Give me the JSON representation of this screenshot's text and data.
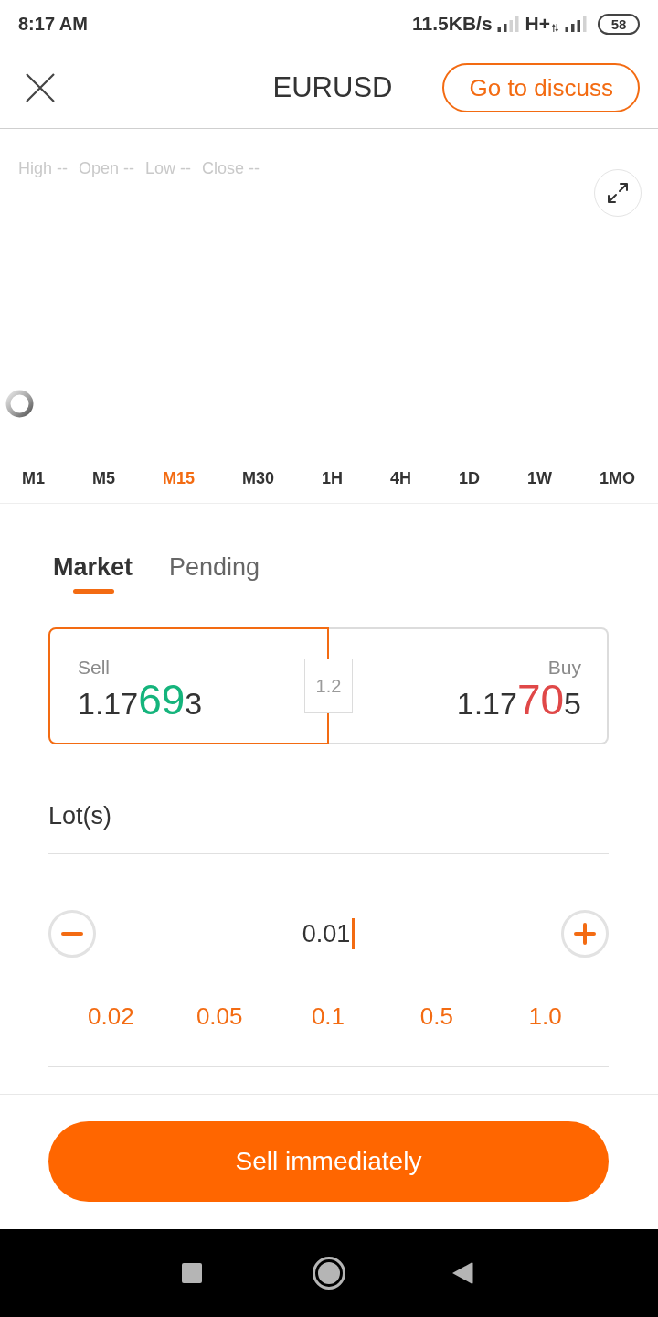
{
  "status_bar": {
    "time": "8:17 AM",
    "data_speed": "11.5KB/s",
    "network_type": "H+",
    "battery": "58"
  },
  "header": {
    "title": "EURUSD",
    "discuss_button": "Go to discuss"
  },
  "chart": {
    "readings": [
      "High --",
      "Open --",
      "Low --",
      "Close --"
    ],
    "loading": true
  },
  "timeframes": [
    {
      "label": "M1",
      "selected": false
    },
    {
      "label": "M5",
      "selected": false
    },
    {
      "label": "M15",
      "selected": true
    },
    {
      "label": "M30",
      "selected": false
    },
    {
      "label": "1H",
      "selected": false
    },
    {
      "label": "4H",
      "selected": false
    },
    {
      "label": "1D",
      "selected": false
    },
    {
      "label": "1W",
      "selected": false
    },
    {
      "label": "1MO",
      "selected": false
    }
  ],
  "order_tabs": [
    {
      "label": "Market",
      "selected": true
    },
    {
      "label": "Pending",
      "selected": false
    }
  ],
  "quote": {
    "sell": {
      "label": "Sell",
      "price": {
        "lead": "1.17",
        "pips": "69",
        "tail": "3"
      },
      "selected": true
    },
    "spread": "1.2",
    "buy": {
      "label": "Buy",
      "price": {
        "lead": "1.17",
        "pips": "70",
        "tail": "5"
      },
      "selected": false
    }
  },
  "lots": {
    "label": "Lot(s)",
    "value": "0.01",
    "focused": true,
    "presets": [
      "0.02",
      "0.05",
      "0.1",
      "0.5",
      "1.0"
    ]
  },
  "submit_button": "Sell immediately"
}
